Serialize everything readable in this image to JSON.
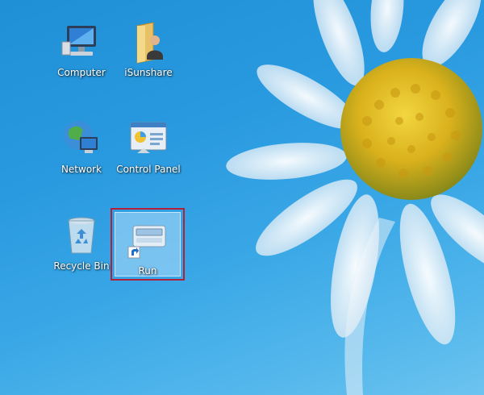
{
  "desktop": {
    "icons": [
      {
        "label": "Computer",
        "icon": "computer-icon"
      },
      {
        "label": "iSunshare",
        "icon": "user-folder-icon"
      },
      {
        "label": "Network",
        "icon": "network-icon"
      },
      {
        "label": "Control Panel",
        "icon": "control-panel-icon"
      },
      {
        "label": "Recycle Bin",
        "icon": "recycle-bin-icon"
      },
      {
        "label": "Run",
        "icon": "run-shortcut-icon",
        "selected": true
      }
    ]
  },
  "colors": {
    "background": "#2a9ae0",
    "selection_fill": "#cde8ff",
    "highlight_border": "#b3203a",
    "label_text": "#ffffff"
  }
}
